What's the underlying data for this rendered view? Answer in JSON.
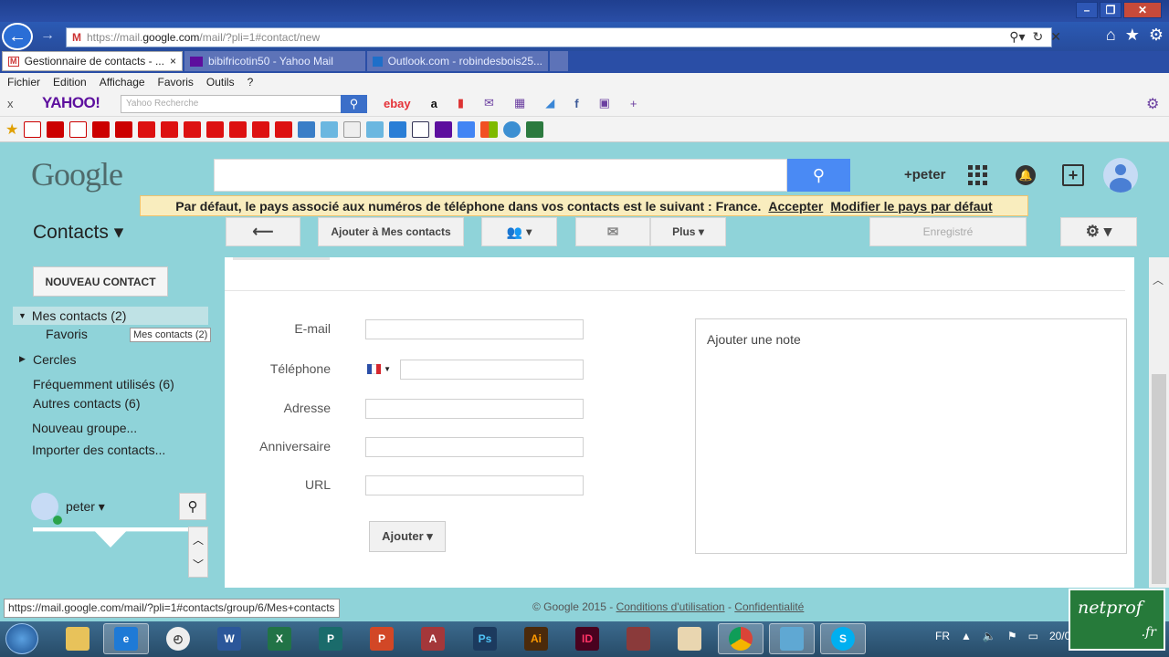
{
  "browser": {
    "url_domain_prefix": "https://mail.",
    "url_domain": "google.com",
    "url_path": "/mail/?pli=1#contact/new",
    "tabs": [
      {
        "label": "Gestionnaire de contacts - ...",
        "close": "×"
      },
      {
        "label": "bibifricotin50 - Yahoo Mail"
      },
      {
        "label": "Outlook.com - robindesbois25..."
      }
    ],
    "menu": [
      "Fichier",
      "Edition",
      "Affichage",
      "Favoris",
      "Outils",
      "?"
    ],
    "yahoo_close": "x",
    "yahoo_logo": "YAHOO!",
    "yahoo_search_placeholder": "Yahoo Recherche",
    "ebay_label": "ebay",
    "amazon_label": "a",
    "status_url": "https://mail.google.com/mail/?pli=1#contacts/group/6/Mes+contacts"
  },
  "google": {
    "logo": "Google",
    "user_handle": "+peter",
    "notice_text": "Par défaut, le pays associé aux numéros de téléphone dans vos contacts est le suivant : France.",
    "notice_accept": "Accepter",
    "notice_modify": "Modifier le pays par défaut"
  },
  "contacts": {
    "title": "Contacts ▾",
    "toolbar": {
      "back": "⟵",
      "add_to_my_contacts": "Ajouter à Mes contacts",
      "groups": "▾",
      "mail": "✉",
      "more": "Plus ▾",
      "saved": "Enregistré",
      "settings": "⚙ ▾"
    },
    "new_contact": "NOUVEAU CONTACT",
    "my_contacts": "Mes contacts (2)",
    "tooltip": "Mes contacts (2)",
    "favorites": "Favoris",
    "circles": "Cercles",
    "frequent": "Fréquemment utilisés (6)",
    "other": "Autres contacts (6)",
    "new_group": "Nouveau groupe...",
    "import": "Importer des contacts...",
    "chat_user": "peter ▾"
  },
  "form": {
    "email_label": "E-mail",
    "phone_label": "Téléphone",
    "address_label": "Adresse",
    "birthday_label": "Anniversaire",
    "url_label": "URL",
    "add_button": "Ajouter ▾",
    "note_placeholder": "Ajouter une note"
  },
  "footer": {
    "copyright": "© Google 2015 -",
    "terms": "Conditions d'utilisation",
    "sep": "-",
    "privacy": "Confidentialité"
  },
  "taskbar": {
    "lang": "FR",
    "date": "20/01/20",
    "watermark": "netprof",
    "watermark_tld": ".fr"
  },
  "colors": {
    "page_bg": "#8fd3d9",
    "accent_blue": "#4a8af4",
    "notice_bg": "#f9edbe"
  }
}
